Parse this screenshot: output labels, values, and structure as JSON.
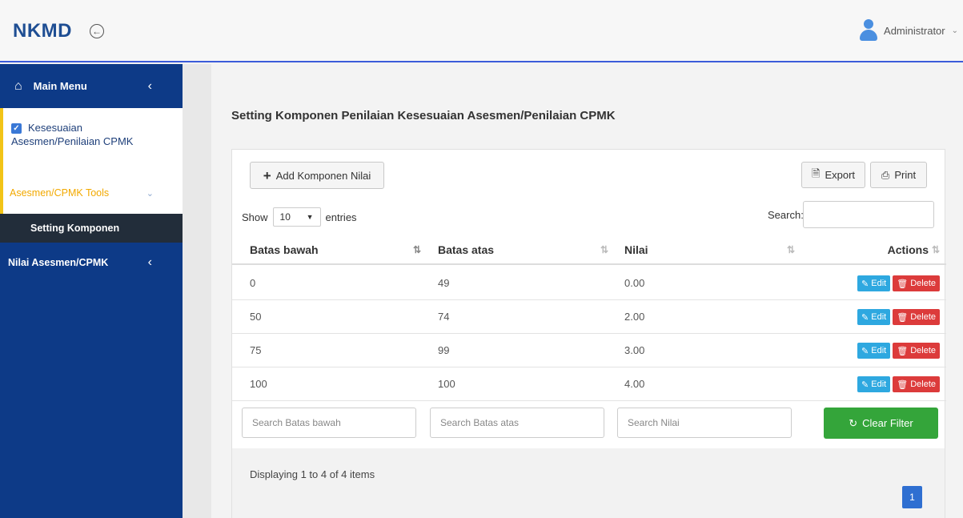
{
  "brand": "NKMD",
  "user": {
    "name": "Administrator"
  },
  "sidebar": {
    "main_menu": "Main Menu",
    "active_item": "Kesesuaian Asesmen/Penilaian CPMK",
    "active_item_line1": "Kesesuaian",
    "active_item_line2": "Asesmen/Penilaian CPMK",
    "tools": "Asesmen/CPMK Tools",
    "sub_item": "Setting Komponen",
    "nilai": "Nilai Asesmen/CPMK"
  },
  "page": {
    "title": "Setting Komponen Penilaian Kesesuaian Asesmen/Penilaian CPMK"
  },
  "toolbar": {
    "add_label": "Add Komponen Nilai",
    "export_label": "Export",
    "print_label": "Print"
  },
  "table_controls": {
    "show_label": "Show",
    "page_size": "10",
    "entries_label": "entries",
    "search_label": "Search:",
    "search_value": ""
  },
  "table": {
    "columns": [
      "Batas bawah",
      "Batas atas",
      "Nilai",
      "Actions"
    ],
    "rows": [
      {
        "batas_bawah": "0",
        "batas_atas": "49",
        "nilai": "0.00"
      },
      {
        "batas_bawah": "50",
        "batas_atas": "74",
        "nilai": "2.00"
      },
      {
        "batas_bawah": "75",
        "batas_atas": "99",
        "nilai": "3.00"
      },
      {
        "batas_bawah": "100",
        "batas_atas": "100",
        "nilai": "4.00"
      }
    ],
    "edit_label": "Edit",
    "delete_label": "Delete"
  },
  "filters": {
    "batas_bawah_placeholder": "Search Batas bawah",
    "batas_atas_placeholder": "Search Batas atas",
    "nilai_placeholder": "Search Nilai",
    "clear_label": "Clear Filter"
  },
  "footer": {
    "display_info": "Displaying 1 to 4 of 4 items",
    "current_page": "1"
  },
  "colors": {
    "sidebar": "#0d3a87",
    "accent_border": "#f2c417",
    "edit": "#2ea8e0",
    "delete": "#dc3b3b",
    "clear": "#34a53a",
    "pager": "#2f6fd1"
  }
}
